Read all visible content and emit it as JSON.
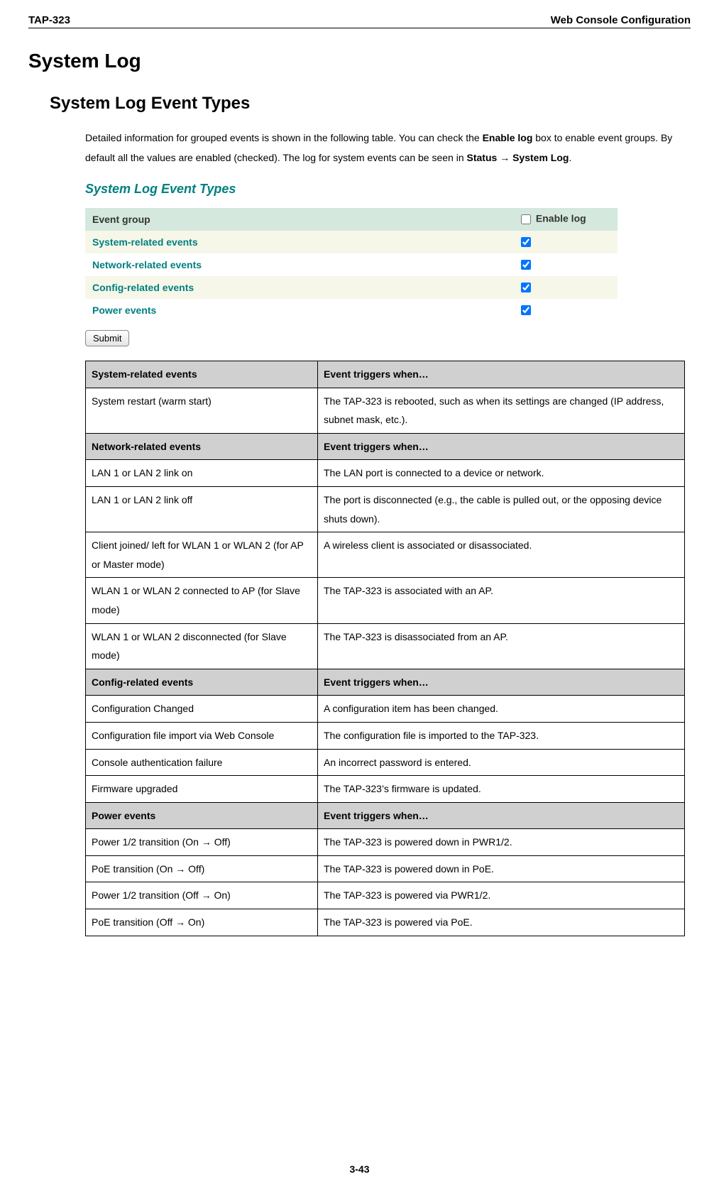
{
  "header": {
    "left": "TAP-323",
    "right": "Web Console Configuration"
  },
  "page_title": "System Log",
  "section_title": "System Log Event Types",
  "intro": {
    "part1": "Detailed information for grouped events is shown in the following table. You can check the ",
    "bold1": "Enable log",
    "part2": " box to enable event groups. By default all the values are enabled (checked). The log for system events can be seen in ",
    "bold2": "Status → System Log",
    "part3": "."
  },
  "panel": {
    "title": "System Log Event Types",
    "col_event_group": "Event group",
    "col_enable_log": "Enable log",
    "rows": [
      {
        "name": "System-related events",
        "checked": true
      },
      {
        "name": "Network-related events",
        "checked": true
      },
      {
        "name": "Config-related events",
        "checked": true
      },
      {
        "name": "Power events",
        "checked": true
      }
    ],
    "submit_label": "Submit"
  },
  "detail_table": {
    "sections": [
      {
        "header_left": "System-related events",
        "header_right": "Event triggers when…",
        "rows": [
          {
            "l": "System restart (warm start)",
            "r": "The TAP-323 is rebooted, such as when its settings are changed (IP address, subnet mask, etc.)."
          }
        ]
      },
      {
        "header_left": "Network-related events",
        "header_right": "Event triggers when…",
        "rows": [
          {
            "l": "LAN 1 or LAN 2 link on",
            "r": "The LAN port is connected to a device or network."
          },
          {
            "l": "LAN 1 or LAN 2 link off",
            "r": "The port is disconnected (e.g., the cable is pulled out, or the opposing device shuts down)."
          },
          {
            "l": "Client joined/ left for WLAN 1 or WLAN 2 (for AP or Master mode)",
            "r": "A wireless client is associated or disassociated."
          },
          {
            "l": "WLAN 1 or WLAN 2 connected to AP (for Slave mode)",
            "r": "The TAP-323 is associated with an AP."
          },
          {
            "l": "WLAN 1 or WLAN 2 disconnected (for Slave mode)",
            "r": "The TAP-323 is disassociated from an AP."
          }
        ]
      },
      {
        "header_left": "Config-related events",
        "header_right": "Event triggers when…",
        "rows": [
          {
            "l": "Configuration Changed",
            "r": "A configuration item has been changed."
          },
          {
            "l": "Configuration file import via Web Console",
            "r": "The configuration file is imported to the TAP-323."
          },
          {
            "l": "Console authentication failure",
            "r": "An incorrect password is entered."
          },
          {
            "l": "Firmware upgraded",
            "r": "The TAP-323’s firmware is updated."
          }
        ]
      },
      {
        "header_left": "Power events",
        "header_right": "Event triggers when…",
        "rows": [
          {
            "l": "Power 1/2 transition (On → Off)",
            "r": "The TAP-323 is powered down in PWR1/2."
          },
          {
            "l": "PoE transition (On → Off)",
            "r": "The TAP-323 is powered down in PoE."
          },
          {
            "l": "Power 1/2 transition (Off → On)",
            "r": "The TAP-323 is powered via PWR1/2."
          },
          {
            "l": "PoE transition (Off → On)",
            "r": "The TAP-323 is powered via PoE."
          }
        ]
      }
    ]
  },
  "footer": "3-43"
}
